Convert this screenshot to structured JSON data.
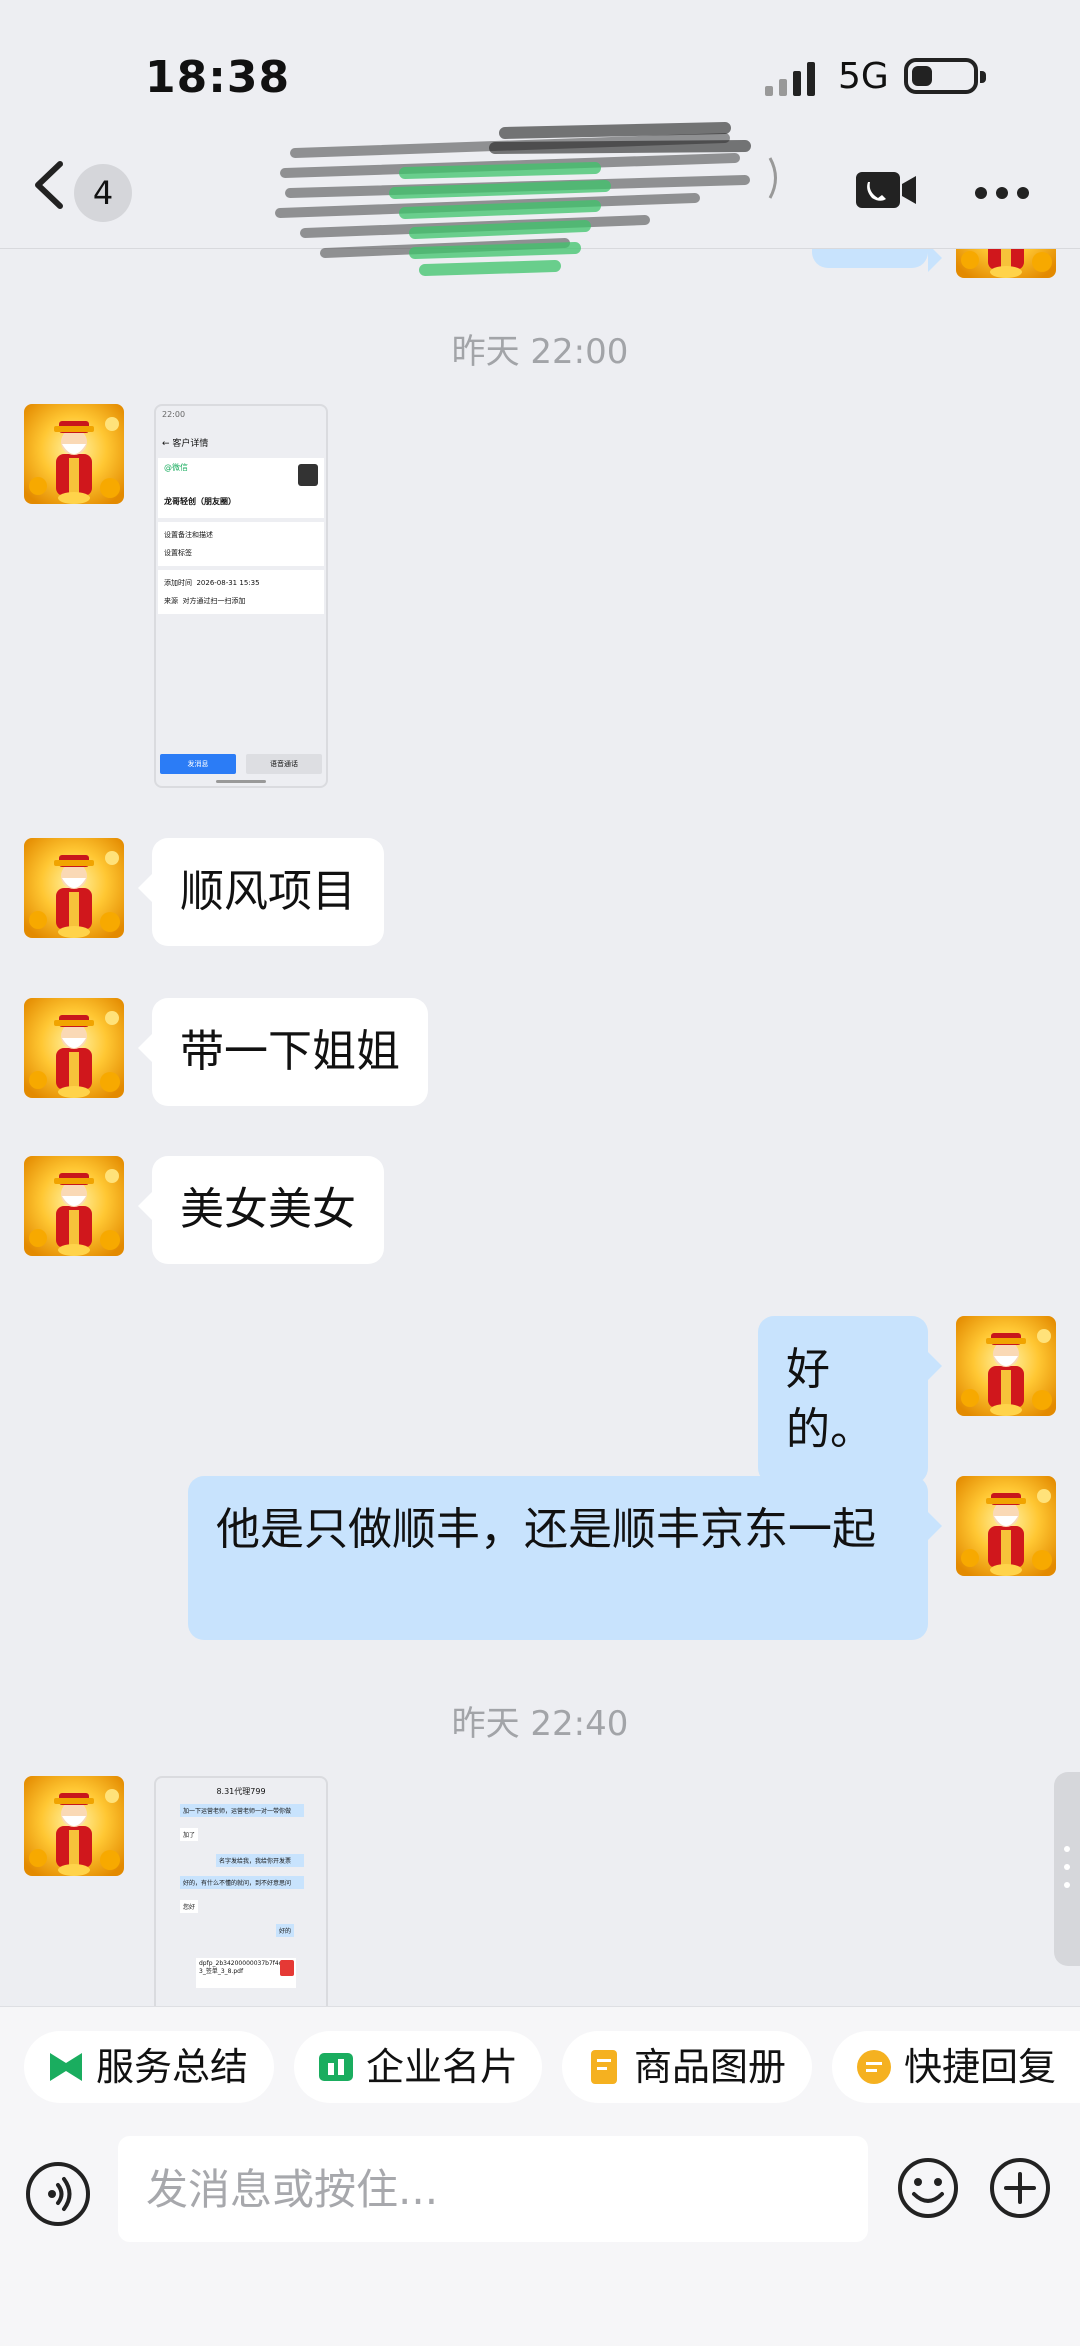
{
  "status_bar": {
    "time": "18:38",
    "network": "5G"
  },
  "header": {
    "unread_count": "4"
  },
  "messages": [
    {
      "type": "timestamp",
      "text": "昨天 22:00"
    },
    {
      "type": "image",
      "side": "left",
      "thumb": {
        "title": "客户详情",
        "source": "@微信",
        "name": "龙哥轻创（朋友圈）",
        "row1": "设置备注和描述",
        "row2": "设置标签",
        "field1_label": "添加时间",
        "field1_value": "2026-08-31 15:35",
        "field2_label": "来源",
        "field2_value": "对方通过扫一扫添加",
        "btn_primary": "发消息",
        "btn_secondary": "语音通话"
      }
    },
    {
      "type": "text",
      "side": "left",
      "text": "顺风项目"
    },
    {
      "type": "text",
      "side": "left",
      "text": "带一下姐姐"
    },
    {
      "type": "text",
      "side": "left",
      "text": "美女美女"
    },
    {
      "type": "text",
      "side": "right",
      "text": "好的。"
    },
    {
      "type": "text",
      "side": "right",
      "text": "他是只做顺丰，还是顺丰京东一起"
    },
    {
      "type": "timestamp",
      "text": "昨天 22:40"
    },
    {
      "type": "image",
      "side": "left",
      "thumb": {
        "title": "8.31代理799",
        "line1": "加一下运营老师，运营老师一对一带你做",
        "line2": "加了",
        "line3": "名字发给我，我给你开发票",
        "line4": "好的，有什么不懂的就问，到不好意思问",
        "line5": "您好",
        "line6": "好的",
        "file_name": "dpfp_2b34200000037b7f4d093_签单_3_8.pdf"
      }
    }
  ],
  "quick_actions": [
    {
      "label": "服务总结",
      "color": "#1AAD5F"
    },
    {
      "label": "企业名片",
      "color": "#1AAD5F"
    },
    {
      "label": "商品图册",
      "color": "#F5B120"
    },
    {
      "label": "快捷回复",
      "color": "#F5B120"
    }
  ],
  "input": {
    "placeholder": "发消息或按住..."
  },
  "colors": {
    "my_bubble": "#C8E3FD",
    "their_bubble": "#FFFFFF",
    "background": "#EDEEF2"
  }
}
